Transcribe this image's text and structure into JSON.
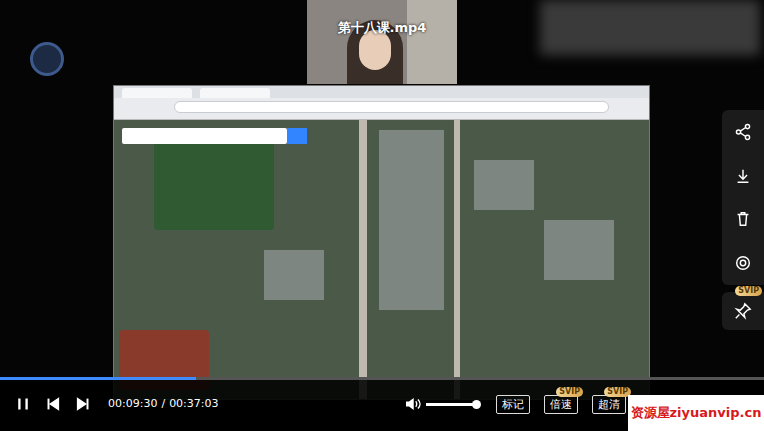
{
  "player": {
    "title": "第十八课.mp4",
    "playing": true,
    "current_time": "00:09:30",
    "total_time": "00:37:03",
    "progress": {
      "level": 0.256
    },
    "volume": {
      "level": 1.0
    }
  },
  "control_buttons": [
    {
      "label": "标记"
    },
    {
      "label": "倍速",
      "badge": "SVIP"
    },
    {
      "label": "超清",
      "badge": "SVIP"
    }
  ],
  "pin_badge": "SVIP",
  "watermark": "资源屋ziyuanvip.cn"
}
